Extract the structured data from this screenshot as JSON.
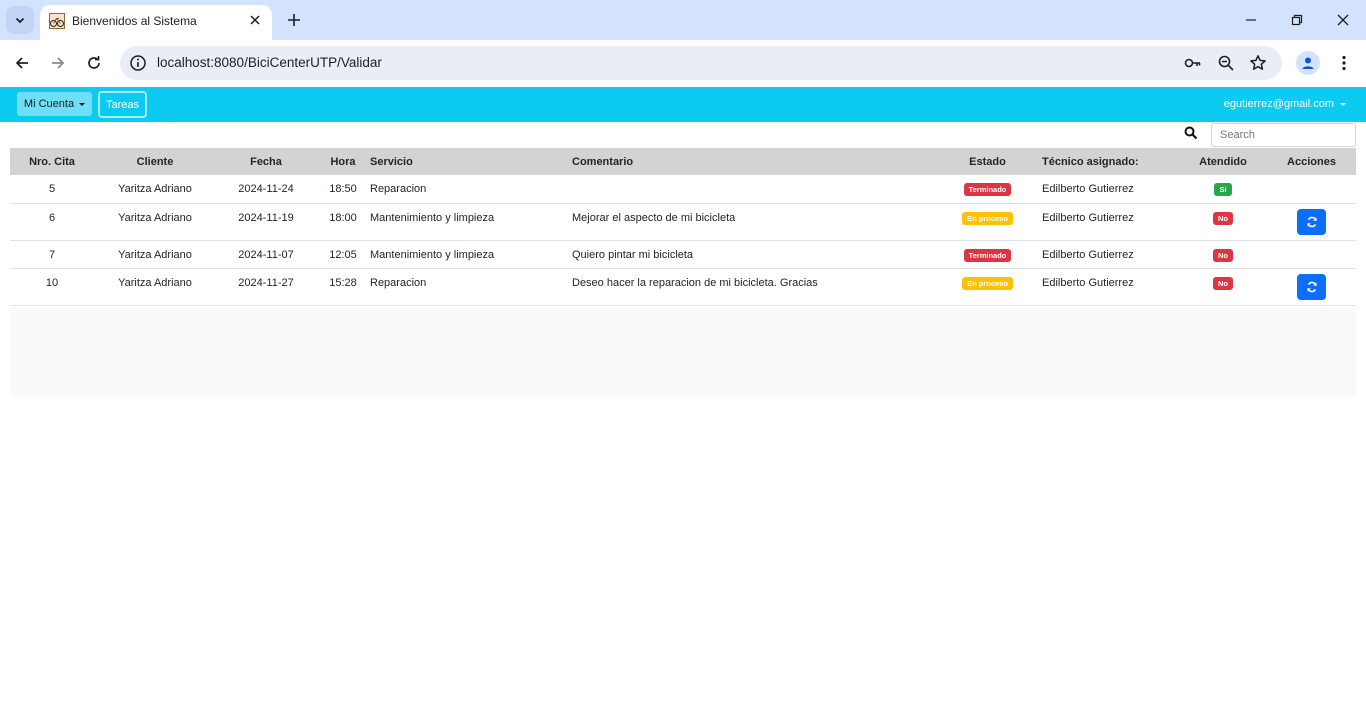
{
  "browser": {
    "tab_title": "Bienvenidos al Sistema",
    "url": "localhost:8080/BiciCenterUTP/Validar"
  },
  "navbar": {
    "account_label": "Mi Cuenta",
    "tasks_label": "Tareas",
    "user_email": "egutierrez@gmail.com",
    "bg_color": "#0dcaf0"
  },
  "search": {
    "placeholder": "Search"
  },
  "table": {
    "headers": [
      "Nro. Cita",
      "Cliente",
      "Fecha",
      "Hora",
      "Servicio",
      "Comentario",
      "Estado",
      "Técnico asignado:",
      "Atendido",
      "Acciones"
    ],
    "rows": [
      {
        "nro": "5",
        "cliente": "Yaritza Adriano",
        "fecha": "2024-11-24",
        "hora": "18:50",
        "servicio": "Reparacion",
        "comentario": "",
        "estado": "Terminado",
        "tecnico": "Edilberto Gutierrez",
        "atendido": "Si",
        "accion": false
      },
      {
        "nro": "6",
        "cliente": "Yaritza Adriano",
        "fecha": "2024-11-19",
        "hora": "18:00",
        "servicio": "Mantenimiento y limpieza",
        "comentario": "Mejorar el aspecto de mi bicicleta",
        "estado": "En proceso",
        "tecnico": "Edilberto Gutierrez",
        "atendido": "No",
        "accion": true
      },
      {
        "nro": "7",
        "cliente": "Yaritza Adriano",
        "fecha": "2024-11-07",
        "hora": "12:05",
        "servicio": "Mantenimiento y limpieza",
        "comentario": "Quiero pintar mi bicicleta",
        "estado": "Terminado",
        "tecnico": "Edilberto Gutierrez",
        "atendido": "No",
        "accion": false
      },
      {
        "nro": "10",
        "cliente": "Yaritza Adriano",
        "fecha": "2024-11-27",
        "hora": "15:28",
        "servicio": "Reparacion",
        "comentario": "Deseo hacer la reparacion de mi bicicleta. Gracias",
        "estado": "En proceso",
        "tecnico": "Edilberto Gutierrez",
        "atendido": "No",
        "accion": true
      }
    ]
  }
}
